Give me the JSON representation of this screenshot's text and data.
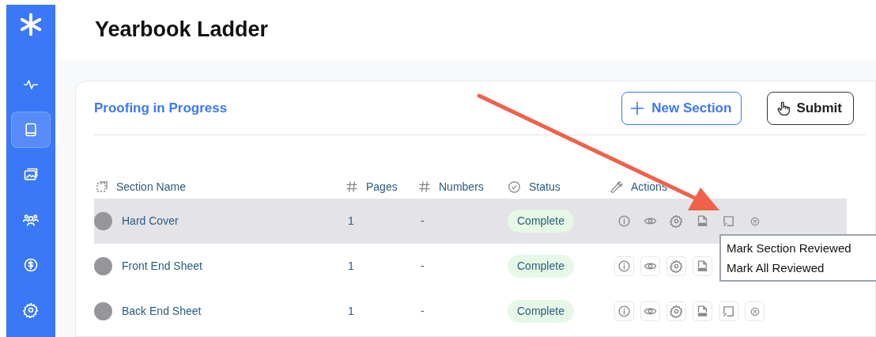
{
  "sidebar": {
    "items": [
      {
        "kind": "activity",
        "selected": false
      },
      {
        "kind": "book",
        "selected": true
      },
      {
        "kind": "images",
        "selected": false
      },
      {
        "kind": "people",
        "selected": false
      },
      {
        "kind": "money",
        "selected": false
      },
      {
        "kind": "settings",
        "selected": false
      }
    ]
  },
  "page_title": "Yearbook Ladder",
  "card": {
    "title": "Proofing in Progress",
    "buttons": [
      {
        "kind": "new",
        "label": "New Section"
      },
      {
        "kind": "submit",
        "label": "Submit"
      }
    ]
  },
  "table": {
    "columns": [
      {
        "kind": "section",
        "label": "Section Name"
      },
      {
        "kind": "hash",
        "label": "Pages"
      },
      {
        "kind": "hash",
        "label": "Numbers"
      },
      {
        "kind": "status",
        "label": "Status"
      },
      {
        "kind": "wrench",
        "label": "Actions"
      }
    ],
    "rows": [
      {
        "name": "Hard Cover",
        "pages": "1",
        "numbers": "-",
        "status": "Complete",
        "hovered": true,
        "actions": [
          {
            "kind": "info"
          },
          {
            "kind": "view"
          },
          {
            "kind": "settings"
          },
          {
            "kind": "pdf"
          },
          {
            "kind": "review"
          },
          {
            "kind": "cancel"
          }
        ]
      },
      {
        "name": "Front End Sheet",
        "pages": "1",
        "numbers": "-",
        "status": "Complete",
        "hovered": false,
        "actions": [
          {
            "kind": "info"
          },
          {
            "kind": "view"
          },
          {
            "kind": "settings"
          },
          {
            "kind": "pdf"
          }
        ]
      },
      {
        "name": "Back End Sheet",
        "pages": "1",
        "numbers": "-",
        "status": "Complete",
        "hovered": false,
        "actions": [
          {
            "kind": "info"
          },
          {
            "kind": "view"
          },
          {
            "kind": "settings"
          },
          {
            "kind": "pdf"
          },
          {
            "kind": "review"
          },
          {
            "kind": "cancel"
          }
        ]
      }
    ]
  },
  "menu": {
    "items": [
      "Mark Section Reviewed",
      "Mark All Reviewed"
    ]
  },
  "annotation": {
    "kind": "arrow"
  }
}
